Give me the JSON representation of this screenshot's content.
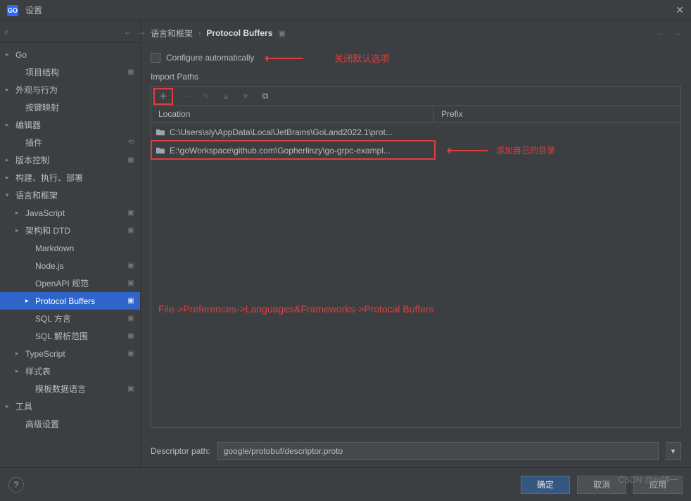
{
  "window": {
    "title": "设置"
  },
  "search": {
    "placeholder": ""
  },
  "tree": [
    {
      "label": "Go",
      "level": 0,
      "arrow": ">",
      "badge": ""
    },
    {
      "label": "项目结构",
      "level": 1,
      "arrow": "",
      "badge": "▣"
    },
    {
      "label": "外观与行为",
      "level": 0,
      "arrow": ">",
      "badge": ""
    },
    {
      "label": "按键映射",
      "level": 1,
      "arrow": "",
      "badge": ""
    },
    {
      "label": "编辑器",
      "level": 0,
      "arrow": ">",
      "badge": ""
    },
    {
      "label": "插件",
      "level": 1,
      "arrow": "",
      "badge": "⟲"
    },
    {
      "label": "版本控制",
      "level": 0,
      "arrow": ">",
      "badge": "▣"
    },
    {
      "label": "构建、执行、部署",
      "level": 0,
      "arrow": ">",
      "badge": ""
    },
    {
      "label": "语言和框架",
      "level": 0,
      "arrow": "v",
      "badge": ""
    },
    {
      "label": "JavaScript",
      "level": 1,
      "arrow": ">",
      "badge": "▣"
    },
    {
      "label": "架构和 DTD",
      "level": 1,
      "arrow": ">",
      "badge": "▣"
    },
    {
      "label": "Markdown",
      "level": 2,
      "arrow": "",
      "badge": ""
    },
    {
      "label": "Node.js",
      "level": 2,
      "arrow": "",
      "badge": "▣"
    },
    {
      "label": "OpenAPI 规范",
      "level": 2,
      "arrow": "",
      "badge": "▣"
    },
    {
      "label": "Protocol Buffers",
      "level": 2,
      "arrow": ">",
      "badge": "▣",
      "selected": true
    },
    {
      "label": "SQL 方言",
      "level": 2,
      "arrow": "",
      "badge": "▣"
    },
    {
      "label": "SQL 解析范围",
      "level": 2,
      "arrow": "",
      "badge": "▣"
    },
    {
      "label": "TypeScript",
      "level": 1,
      "arrow": ">",
      "badge": "▣"
    },
    {
      "label": "样式表",
      "level": 1,
      "arrow": ">",
      "badge": ""
    },
    {
      "label": "模板数据语言",
      "level": 2,
      "arrow": "",
      "badge": "▣"
    },
    {
      "label": "工具",
      "level": 0,
      "arrow": ">",
      "badge": ""
    },
    {
      "label": "高级设置",
      "level": 1,
      "arrow": "",
      "badge": ""
    }
  ],
  "breadcrumb": {
    "a": "语言和框架",
    "b": "Protocol Buffers"
  },
  "panel": {
    "configure_label": "Configure automatically",
    "annot_close": "关闭默认选项",
    "import_paths_title": "Import Paths",
    "columns": {
      "location": "Location",
      "prefix": "Prefix"
    },
    "rows": [
      {
        "path": "C:\\Users\\sly\\AppData\\Local\\JetBrains\\GoLand2022.1\\prot..."
      },
      {
        "path": "E:\\goWorkspace\\github.com\\Gopherlinzy\\go-grpc-exampl..."
      }
    ],
    "annot_add": "添加自己的目录",
    "center_hint": "File->Preferences->Languages&Frameworks->Protocal Buffers",
    "descriptor_label": "Descriptor path:",
    "descriptor_value": "google/protobuf/descriptor.proto"
  },
  "footer": {
    "ok": "确定",
    "cancel": "取消",
    "apply": "应用"
  },
  "watermark": "CSDN @lin钟一"
}
